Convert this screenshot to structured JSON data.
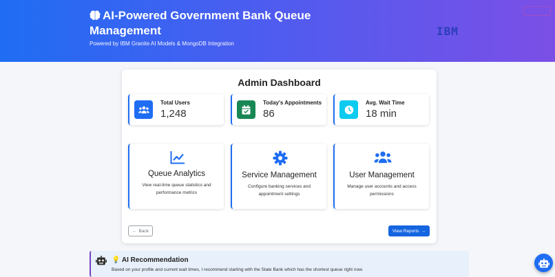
{
  "header": {
    "title": "AI-Powered Government Bank Queue Management",
    "subtitle": "Powered by IBM Granite AI Models & MongoDB Integration",
    "logo_text": "IBM",
    "brain_icon": "brain-icon"
  },
  "dashboard": {
    "title": "Admin Dashboard",
    "stats": [
      {
        "label": "Total Users",
        "value": "1,248",
        "icon": "users-icon",
        "color": "#1f6df3"
      },
      {
        "label": "Today's Appointments",
        "value": "86",
        "icon": "calendar-check-icon",
        "color": "#198754"
      },
      {
        "label": "Avg. Wait Time",
        "value": "18 min",
        "icon": "clock-icon",
        "color": "#0dcaf0"
      }
    ],
    "features": [
      {
        "title": "Queue Analytics",
        "description": "View real-time queue statistics and performance metrics",
        "icon": "line-chart-icon"
      },
      {
        "title": "Service Management",
        "description": "Configure banking services and appointment settings",
        "icon": "gear-icon"
      },
      {
        "title": "User Management",
        "description": "Manage user accounts and access permissions",
        "icon": "users-icon"
      }
    ],
    "back_label": "Back",
    "view_reports_label": "View Reports"
  },
  "recommendation": {
    "title": "AI Recommendation",
    "text": "Based on your profile and current wait times, I recommend starting with the State Bank which has the shortest queue right now."
  },
  "colors": {
    "primary": "#1f6df3",
    "accent": "#7b4fe6",
    "success": "#198754",
    "info": "#0dcaf0"
  }
}
